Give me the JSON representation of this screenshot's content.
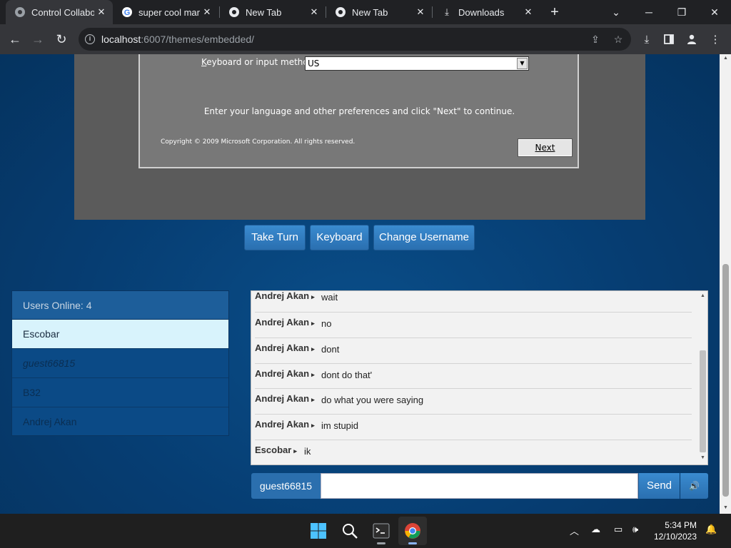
{
  "browser": {
    "tabs": [
      {
        "title": "Control Collabo",
        "active": true,
        "icon": "chrome-globe-icon"
      },
      {
        "title": "super cool mar",
        "active": false,
        "icon": "google-icon"
      },
      {
        "title": "New Tab",
        "active": false,
        "icon": "chrome-icon"
      },
      {
        "title": "New Tab",
        "active": false,
        "icon": "chrome-icon"
      },
      {
        "title": "Downloads",
        "active": false,
        "icon": "download-icon"
      }
    ],
    "url_host": "localhost",
    "url_path": ":6007/themes/embedded/"
  },
  "vm_dialog": {
    "keyboard_label_prefix": "K",
    "keyboard_label_rest": "eyboard or input method:",
    "keyboard_value": "US",
    "hint": "Enter your language and other preferences and click \"Next\" to continue.",
    "copyright": "Copyright © 2009 Microsoft Corporation. All rights reserved.",
    "next_label": "Next"
  },
  "controls": {
    "take_turn": "Take Turn",
    "keyboard": "Keyboard",
    "change_username": "Change Username"
  },
  "users": {
    "header": "Users Online: 4",
    "list": [
      "Escobar",
      "guest66815",
      "B32",
      "Andrej Akan"
    ]
  },
  "chat": {
    "messages": [
      {
        "user": "Andrej Akan",
        "text": "wait"
      },
      {
        "user": "Andrej Akan",
        "text": "no"
      },
      {
        "user": "Andrej Akan",
        "text": "dont"
      },
      {
        "user": "Andrej Akan",
        "text": "dont do that'"
      },
      {
        "user": "Andrej Akan",
        "text": "do what you were saying"
      },
      {
        "user": "Andrej Akan",
        "text": "im stupid"
      },
      {
        "user": "Escobar",
        "text": "ik"
      }
    ],
    "username": "guest66815",
    "send_label": "Send"
  },
  "taskbar": {
    "time": "5:34 PM",
    "date": "12/10/2023"
  },
  "colors": {
    "page_bg": "#063d72",
    "button_blue": "#2a6fb0",
    "selected_user": "#d8f3fc"
  }
}
